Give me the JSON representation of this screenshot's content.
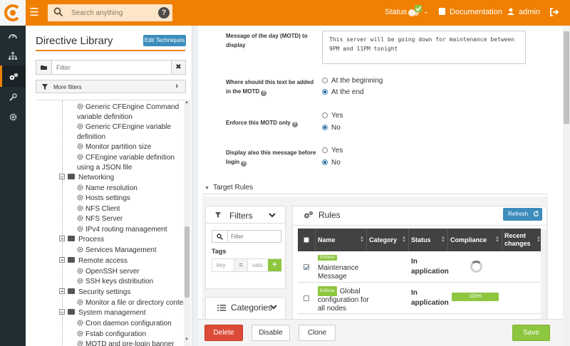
{
  "topbar": {
    "search_placeholder": "Search anything",
    "status_label": "Status",
    "documentation_label": "Documentation",
    "user_label": "admin"
  },
  "colors": {
    "brand": "#f08004",
    "primary": "#3c8dbc",
    "success": "#8dc63f",
    "danger": "#dd4b39",
    "sidebar": "#222d32"
  },
  "library": {
    "title": "Directive Library",
    "edit_techniques": "Edit Techniques",
    "filter_placeholder": "Filter",
    "more_filters": "More filters",
    "tree": [
      {
        "kind": "item",
        "label": "Generic CFEngine Command",
        "label2": "variable definition"
      },
      {
        "kind": "item",
        "label": "Generic CFEngine variable",
        "label2": "definition"
      },
      {
        "kind": "item",
        "label": "Monitor partition size"
      },
      {
        "kind": "item",
        "label": "CFEngine variable definition",
        "label2": "using a JSON file"
      },
      {
        "kind": "category",
        "label": "Networking"
      },
      {
        "kind": "item",
        "label": "Name resolution"
      },
      {
        "kind": "item",
        "label": "Hosts settings"
      },
      {
        "kind": "item",
        "label": "NFS Client"
      },
      {
        "kind": "item",
        "label": "NFS Server"
      },
      {
        "kind": "item",
        "label": "IPv4 routing management"
      },
      {
        "kind": "category",
        "label": "Process"
      },
      {
        "kind": "item",
        "label": "Services Management"
      },
      {
        "kind": "category",
        "label": "Remote access"
      },
      {
        "kind": "item",
        "label": "OpenSSH server"
      },
      {
        "kind": "item",
        "label": "SSH keys distribution"
      },
      {
        "kind": "category",
        "label": "Security settings"
      },
      {
        "kind": "item",
        "label": "Monitor a file or directory content"
      },
      {
        "kind": "category",
        "label": "System management"
      },
      {
        "kind": "item",
        "label": "Cron daemon configuration"
      },
      {
        "kind": "item",
        "label": "Fstab configuration"
      },
      {
        "kind": "item",
        "label": "MOTD and pre-login banner"
      }
    ]
  },
  "form": {
    "motd_label": "Message of the day (MOTD) to display",
    "motd_value": "This server will be going down for maintenance between 9PM and 11PM tonight",
    "where_label": "Where should this text be added in the MOTD",
    "where_options": [
      "At the beginning",
      "At the end"
    ],
    "where_selected": 1,
    "enforce_label": "Enforce this MOTD only",
    "enforce_options": [
      "Yes",
      "No"
    ],
    "enforce_selected": 1,
    "display_label": "Display also this message before login",
    "display_options": [
      "Yes",
      "No"
    ],
    "display_selected": 1
  },
  "target_rules": {
    "title": "Target Rules",
    "filters_title": "Filters",
    "filter_placeholder": "Filter",
    "tags_label": "Tags",
    "tag_key_placeholder": "key",
    "tag_eq": "=",
    "tag_value_placeholder": "valu",
    "tag_add": "+",
    "categories_title": "Categories",
    "rules_title": "Rules",
    "refresh_label": "Refresh",
    "columns": [
      "Name",
      "Category",
      "Status",
      "Compliance",
      "Recent changes"
    ],
    "rows": [
      {
        "checked": true,
        "badge": "Enforce",
        "name": "Maintenance Message",
        "category": "",
        "status": "In application",
        "compliance": "loading"
      },
      {
        "checked": false,
        "badge": "Enforce",
        "name": "Global configuration for all nodes",
        "category": "",
        "status": "In application",
        "compliance": "100%",
        "compliance_value": 100
      }
    ]
  },
  "actions": {
    "delete": "Delete",
    "disable": "Disable",
    "clone": "Clone",
    "save": "Save"
  }
}
